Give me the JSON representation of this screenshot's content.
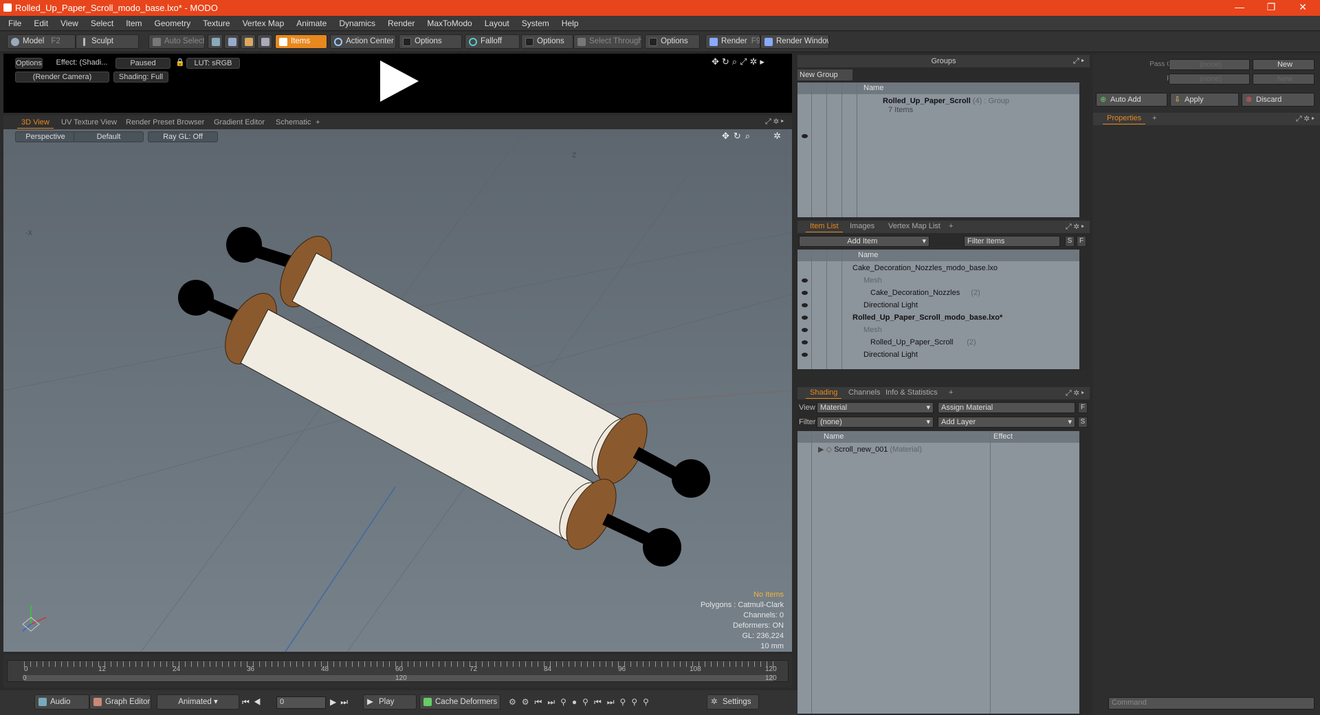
{
  "window": {
    "title": "Rolled_Up_Paper_Scroll_modo_base.lxo* - MODO",
    "minimize": "—",
    "restore": "❐",
    "close": "✕"
  },
  "menu": [
    "File",
    "Edit",
    "View",
    "Select",
    "Item",
    "Geometry",
    "Texture",
    "Vertex Map",
    "Animate",
    "Dynamics",
    "Render",
    "MaxToModo",
    "Layout",
    "System",
    "Help"
  ],
  "toolbar": {
    "model": "Model",
    "model_key": "F2",
    "sculpt": "Sculpt",
    "auto_select": "Auto Select",
    "items": "Items",
    "action_center": "Action Center",
    "options1": "Options",
    "falloff": "Falloff",
    "options2": "Options",
    "select_through": "Select Through",
    "options3": "Options",
    "render": "Render",
    "render_key": "F9",
    "render_window": "Render Window"
  },
  "preview": {
    "options": "Options",
    "effect": "Effect: (Shadi...",
    "paused": "Paused",
    "lut": "LUT: sRGB",
    "camera": "(Render Camera)",
    "shading": "Shading: Full"
  },
  "viewport_tabs": [
    "3D View",
    "UV Texture View",
    "Render Preset Browser",
    "Gradient Editor",
    "Schematic",
    "+"
  ],
  "viewport": {
    "perspective": "Perspective",
    "default": "Default",
    "raygl": "Ray GL: Off",
    "axis_z": "Z",
    "axis_x": "-X",
    "stats": {
      "warn": "No Items",
      "polygons": "Polygons : Catmull-Clark",
      "channels": "Channels: 0",
      "deformers": "Deformers: ON",
      "gl": "GL: 236,224",
      "unit": "10 mm"
    }
  },
  "timeline": {
    "ticks": [
      "0",
      "12",
      "24",
      "36",
      "48",
      "60",
      "72",
      "84",
      "96",
      "108",
      "120"
    ],
    "start": "0",
    "mid": "120",
    "end": "120"
  },
  "bottom": {
    "audio": "Audio",
    "graph_editor": "Graph Editor",
    "animated": "Animated",
    "frame": "0",
    "play": "Play",
    "cache": "Cache Deformers",
    "settings": "Settings"
  },
  "groups": {
    "title": "Groups",
    "new_group": "New Group",
    "name_col": "Name",
    "item": {
      "name": "Rolled_Up_Paper_Scroll",
      "count": "(4)",
      "type": ": Group",
      "sub": "7 Items"
    }
  },
  "passes": {
    "pass_groups": "Pass Groups",
    "passes": "Passes",
    "none1": "(none)",
    "none2": "(none)",
    "new1": "New",
    "new2": "New",
    "auto_add": "Auto Add",
    "apply": "Apply",
    "discard": "Discard",
    "properties_tab": "Properties",
    "plus": "+"
  },
  "itemlist": {
    "tabs": [
      "Item List",
      "Images",
      "Vertex Map List",
      "+"
    ],
    "add_item": "Add Item",
    "filter": "Filter Items",
    "s": "S",
    "f": "F",
    "name_col": "Name",
    "rows": [
      {
        "label": "Cake_Decoration_Nozzles_modo_base.lxo",
        "indent": 0,
        "style": "normal",
        "count": ""
      },
      {
        "label": "Mesh",
        "indent": 2,
        "style": "dim",
        "count": ""
      },
      {
        "label": "Cake_Decoration_Nozzles",
        "indent": 1,
        "style": "normal",
        "count": "(2)"
      },
      {
        "label": "Directional Light",
        "indent": 2,
        "style": "normal",
        "count": ""
      },
      {
        "label": "Rolled_Up_Paper_Scroll_modo_base.lxo*",
        "indent": 0,
        "style": "bold",
        "count": ""
      },
      {
        "label": "Mesh",
        "indent": 2,
        "style": "dim",
        "count": ""
      },
      {
        "label": "Rolled_Up_Paper_Scroll",
        "indent": 1,
        "style": "normal",
        "count": "(2)"
      },
      {
        "label": "Directional Light",
        "indent": 2,
        "style": "normal",
        "count": ""
      }
    ]
  },
  "shading": {
    "tabs": [
      "Shading",
      "Channels",
      "Info & Statistics",
      "+"
    ],
    "view_lbl": "View",
    "view_val": "Material",
    "assign": "Assign Material",
    "filter_lbl": "Filter",
    "filter_val": "(none)",
    "add_layer": "Add Layer",
    "name_col": "Name",
    "effect_col": "Effect",
    "row_name": "Scroll_new_001",
    "row_type": "(Material)"
  },
  "command": {
    "placeholder": "Command"
  },
  "colors": {
    "accent": "#e8881e",
    "titlebar": "#e8451c"
  }
}
